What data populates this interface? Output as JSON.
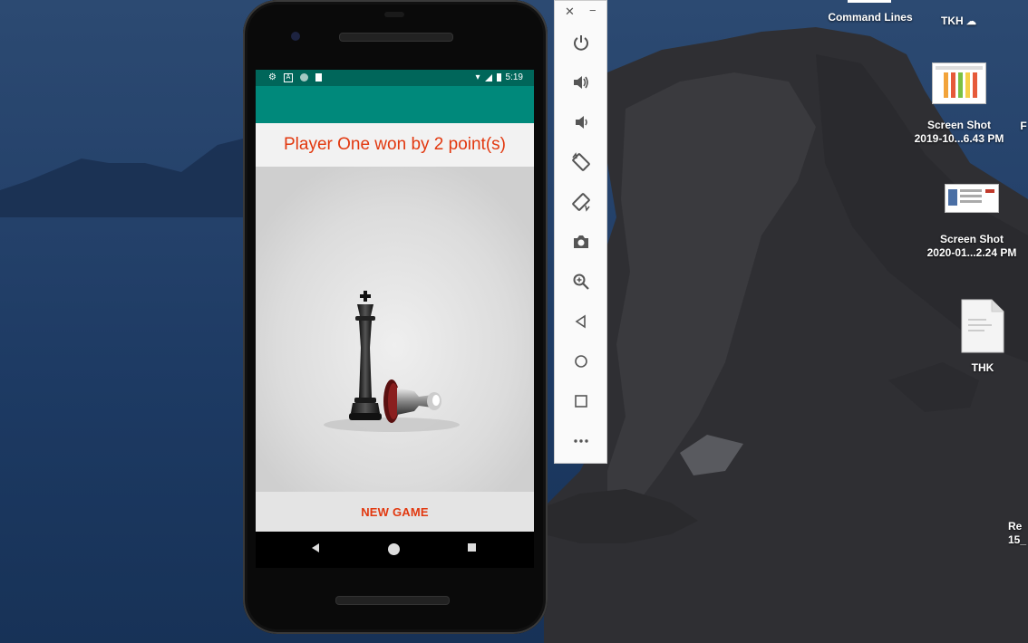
{
  "status_bar": {
    "time": "5:19"
  },
  "app": {
    "result_text": "Player One won by 2 point(s)",
    "new_game_label": "NEW GAME"
  },
  "emulator_toolbar": {
    "close_glyph": "✕",
    "minimize_glyph": "−",
    "buttons": [
      "power-icon",
      "volume-up-icon",
      "volume-down-icon",
      "rotate-left-icon",
      "rotate-right-icon",
      "camera-icon",
      "zoom-icon",
      "back-icon",
      "home-icon",
      "overview-icon",
      "more-icon"
    ]
  },
  "desktop": {
    "command_lines_label": "Command Lines",
    "tkh_label": "TKH",
    "screenshot1": [
      "Screen Shot",
      "2019-10...6.43 PM"
    ],
    "screenshot2": [
      "Screen Shot",
      "2020-01...2.24 PM"
    ],
    "thk_label": "THK",
    "edge_label_1": "F",
    "edge_label_2": [
      "Re",
      "15_"
    ]
  },
  "colors": {
    "status_bar": "#00665a",
    "app_bar": "#00897b",
    "accent_text": "#e2380f"
  }
}
